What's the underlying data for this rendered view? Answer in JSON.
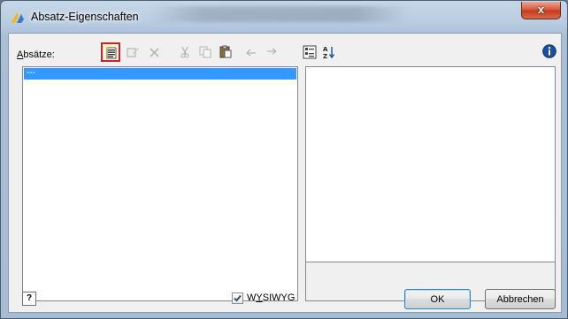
{
  "window": {
    "title": "Absatz-Eigenschaften",
    "close_label": "x"
  },
  "toolbar": {
    "absaetze_label_first": "A",
    "absaetze_label_rest": "bsätze:"
  },
  "list": {
    "items": [
      "---"
    ]
  },
  "footer": {
    "help_label": "?",
    "wysiwyg_label_pre": "W",
    "wysiwyg_label_under": "Y",
    "wysiwyg_label_post": "SIWYG",
    "wysiwyg_checked": true,
    "ok_label": "OK",
    "cancel_label": "Abbrechen"
  },
  "colors": {
    "selection": "#3399ff",
    "active_tool_border": "#d0202a",
    "info_icon": "#1b4fa0"
  }
}
